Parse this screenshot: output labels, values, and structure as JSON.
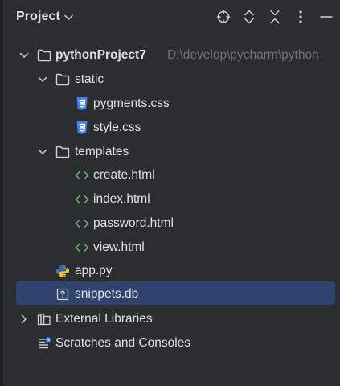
{
  "header": {
    "title": "Project"
  },
  "tree": {
    "root": {
      "label": "pythonProject7",
      "path": "D:\\develop\\pycharm\\python"
    },
    "static_folder": {
      "label": "static"
    },
    "pygments_css": {
      "label": "pygments.css"
    },
    "style_css": {
      "label": "style.css"
    },
    "templates_folder": {
      "label": "templates"
    },
    "create_html": {
      "label": "create.html"
    },
    "index_html": {
      "label": "index.html"
    },
    "password_html": {
      "label": "password.html"
    },
    "view_html": {
      "label": "view.html"
    },
    "app_py": {
      "label": "app.py"
    },
    "snippets_db": {
      "label": "snippets.db"
    },
    "external_libraries": {
      "label": "External Libraries"
    },
    "scratches": {
      "label": "Scratches and Consoles"
    }
  },
  "colors": {
    "background": "#2b2d30",
    "selection": "#2e436e",
    "text": "#dfe1e5",
    "muted_text": "#6f737a",
    "css_icon": "#3b82f6",
    "html_icon": "#5fb865"
  }
}
